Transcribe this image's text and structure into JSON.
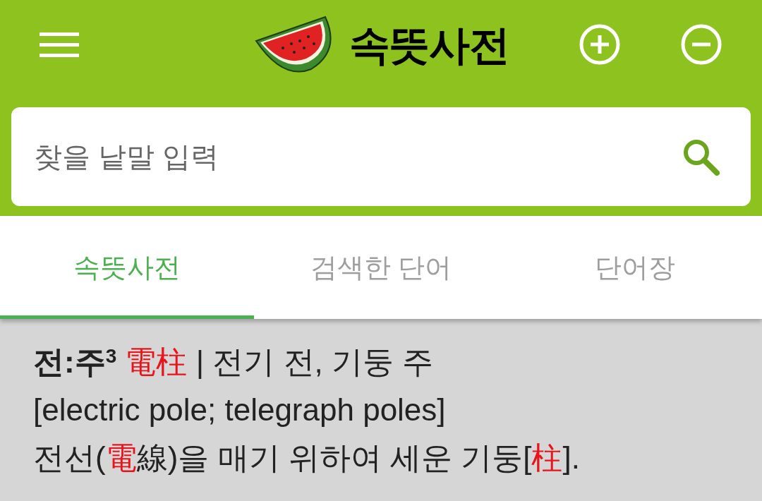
{
  "app_bar": {
    "title": "속뜻사전"
  },
  "search": {
    "placeholder": "찾을 낱말 입력"
  },
  "tabs": [
    {
      "label": "속뜻사전",
      "selected": true
    },
    {
      "label": "검색한 단어",
      "selected": false
    },
    {
      "label": "단어장",
      "selected": false
    }
  ],
  "entry": {
    "headword": "전:주",
    "homonym_number": "3",
    "hanja": "電柱",
    "gloss": "| 전기 전, 기둥 주",
    "english": "[electric pole; telegraph poles]",
    "definition": [
      {
        "text": "전선(",
        "highlight": false
      },
      {
        "text": "電",
        "highlight": true
      },
      {
        "text": "線)을 매기 위하여 세운 기둥[",
        "highlight": false
      },
      {
        "text": "柱",
        "highlight": true
      },
      {
        "text": "].",
        "highlight": false
      }
    ]
  }
}
